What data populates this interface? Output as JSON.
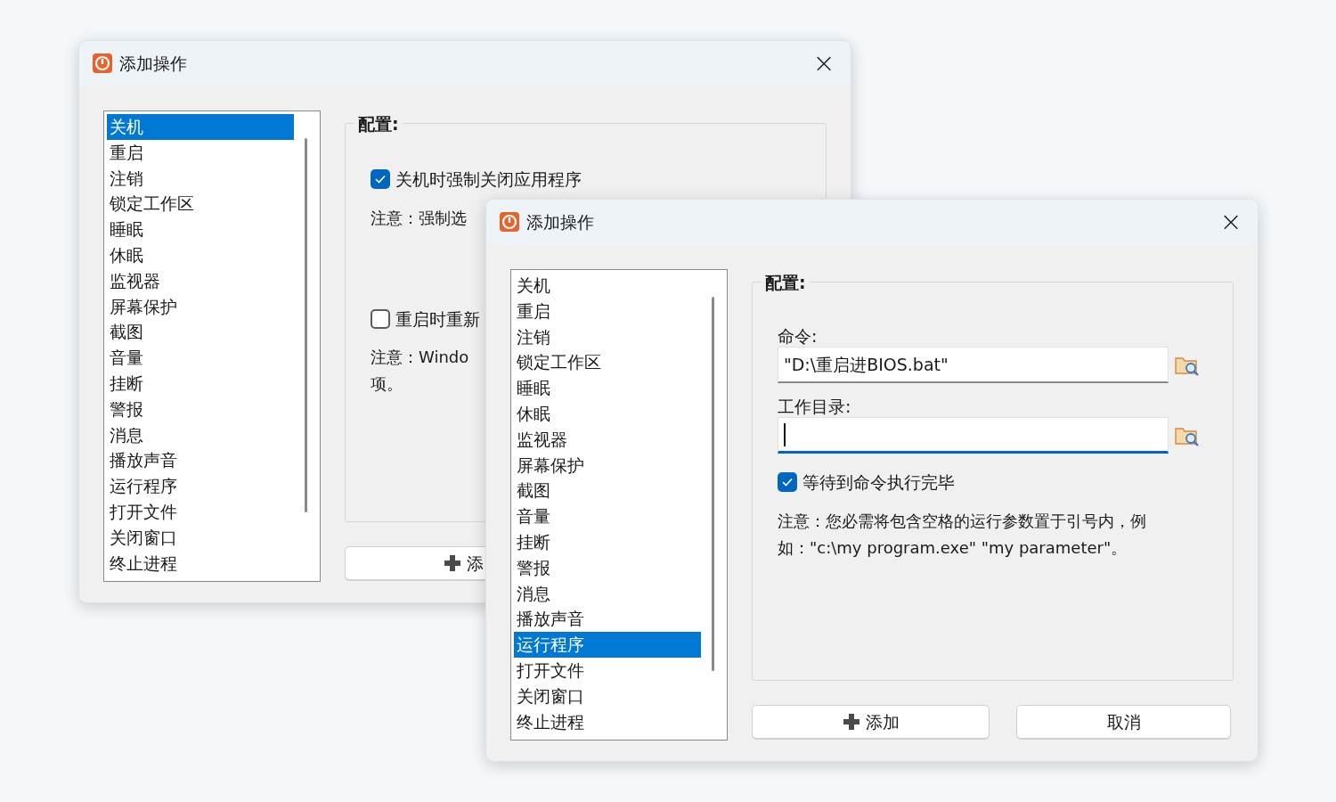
{
  "windows": [
    {
      "title": "添加操作",
      "close": "×",
      "items": [
        {
          "label": "关机",
          "selected": true
        },
        {
          "label": "重启",
          "selected": false
        },
        {
          "label": "注销",
          "selected": false
        },
        {
          "label": "锁定工作区",
          "selected": false
        },
        {
          "label": "睡眠",
          "selected": false
        },
        {
          "label": "休眠",
          "selected": false
        },
        {
          "label": "监视器",
          "selected": false
        },
        {
          "label": "屏幕保护",
          "selected": false
        },
        {
          "label": "截图",
          "selected": false
        },
        {
          "label": "音量",
          "selected": false
        },
        {
          "label": "挂断",
          "selected": false
        },
        {
          "label": "警报",
          "selected": false
        },
        {
          "label": "消息",
          "selected": false
        },
        {
          "label": "播放声音",
          "selected": false
        },
        {
          "label": "运行程序",
          "selected": false
        },
        {
          "label": "打开文件",
          "selected": false
        },
        {
          "label": "关闭窗口",
          "selected": false
        },
        {
          "label": "终止进程",
          "selected": false
        }
      ],
      "group": "配置:",
      "controls": [
        {
          "kind": "checkbox",
          "label": "关机时强制关闭应用程序",
          "checked": true
        },
        {
          "kind": "note",
          "text": "注意：强制选"
        },
        {
          "kind": "checkbox",
          "label": "重启时重新",
          "checked": false
        },
        {
          "kind": "note",
          "text": "注意：Windo\n项。"
        }
      ],
      "buttons": [
        {
          "label": "添",
          "kind": "add"
        }
      ]
    },
    {
      "title": "添加操作",
      "close": "×",
      "items": [
        {
          "label": "关机",
          "selected": false
        },
        {
          "label": "重启",
          "selected": false
        },
        {
          "label": "注销",
          "selected": false
        },
        {
          "label": "锁定工作区",
          "selected": false
        },
        {
          "label": "睡眠",
          "selected": false
        },
        {
          "label": "休眠",
          "selected": false
        },
        {
          "label": "监视器",
          "selected": false
        },
        {
          "label": "屏幕保护",
          "selected": false
        },
        {
          "label": "截图",
          "selected": false
        },
        {
          "label": "音量",
          "selected": false
        },
        {
          "label": "挂断",
          "selected": false
        },
        {
          "label": "警报",
          "selected": false
        },
        {
          "label": "消息",
          "selected": false
        },
        {
          "label": "播放声音",
          "selected": false
        },
        {
          "label": "运行程序",
          "selected": true
        },
        {
          "label": "打开文件",
          "selected": false
        },
        {
          "label": "关闭窗口",
          "selected": false
        },
        {
          "label": "终止进程",
          "selected": false
        }
      ],
      "group": "配置:",
      "controls": [
        {
          "kind": "field",
          "label": "命令:",
          "value": "\"D:\\重启进BIOS.bat\"",
          "focused": false
        },
        {
          "kind": "field",
          "label": "工作目录:",
          "focused": true
        },
        {
          "kind": "checkbox",
          "label": "等待到命令执行完毕",
          "checked": true
        },
        {
          "kind": "note",
          "text": "注意：您必需将包含空格的运行参数置于引号内，例如：\"c:\\my program.exe\" \"my parameter\"。"
        }
      ],
      "buttons": [
        {
          "label": "添加",
          "kind": "add"
        },
        {
          "label": "取消",
          "kind": "cancel"
        }
      ]
    }
  ]
}
